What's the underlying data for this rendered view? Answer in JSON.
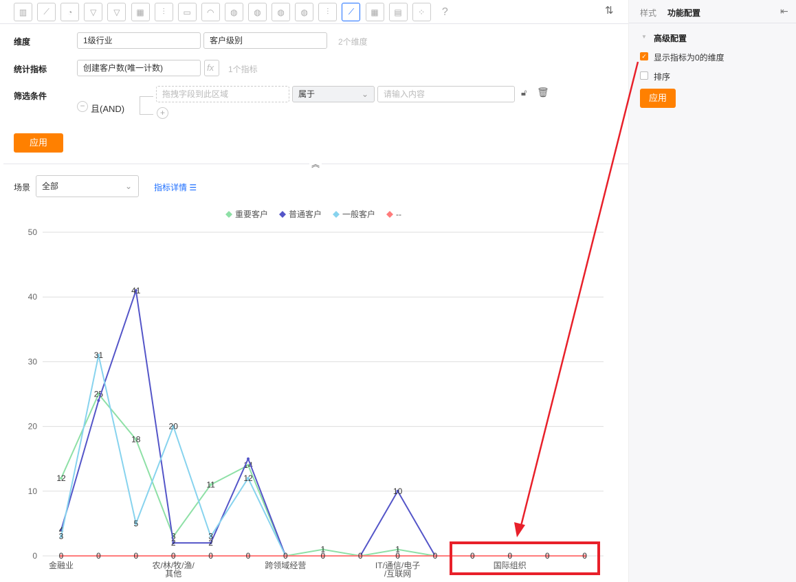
{
  "toolbar": {
    "icons": [
      "bar-chart",
      "line-chart",
      "pie-chart",
      "funnel",
      "funnel-compare",
      "table",
      "combo-chart",
      "card",
      "gauge",
      "china-map",
      "china-map-bubble",
      "world-map",
      "world-map-bubble",
      "bar-chart-thin",
      "line-chart-area",
      "heatmap",
      "detail-table",
      "scatter",
      "help"
    ],
    "active_index": 14,
    "help_glyph": "?"
  },
  "form": {
    "dimension_label": "维度",
    "dimensions": [
      "1级行业",
      "客户级别"
    ],
    "dimension_count": "2个维度",
    "metric_label": "统计指标",
    "metric": "创建客户数(唯一计数)",
    "fx": "fx",
    "metric_count": "1个指标",
    "filter_label": "筛选条件",
    "logic": "且(AND)",
    "drop_placeholder": "拖拽字段到此区域",
    "operator": "属于",
    "value_placeholder": "请输入内容",
    "apply": "应用"
  },
  "scene": {
    "label": "场景",
    "value": "全部",
    "detail_link": "指标详情"
  },
  "side": {
    "tabs": [
      "样式",
      "功能配置"
    ],
    "active_tab": 1,
    "section": "高级配置",
    "options": [
      {
        "label": "显示指标为0的维度",
        "checked": true
      },
      {
        "label": "排序",
        "checked": false
      }
    ],
    "apply": "应用"
  },
  "chart_data": {
    "type": "line",
    "categories": [
      "金融业",
      "",
      "",
      "农/林/牧/渔/其他",
      "",
      "",
      "跨领域经营",
      "",
      "",
      "IT/通信/电子/互联网",
      "",
      "",
      "国际组织",
      "",
      ""
    ],
    "ylim": [
      0,
      50
    ],
    "yticks": [
      0,
      10,
      20,
      30,
      40,
      50
    ],
    "grid": true,
    "legend": "top",
    "series": [
      {
        "name": "重要客户",
        "color": "#8ee0a6",
        "values": [
          12,
          25,
          18,
          3,
          11,
          14,
          0,
          1,
          0,
          1,
          0,
          0,
          0,
          0,
          0
        ]
      },
      {
        "name": "普通客户",
        "color": "#5455c8",
        "values": [
          4,
          24,
          41,
          2,
          2,
          15,
          0,
          0,
          0,
          10,
          0,
          0,
          0,
          0,
          0
        ]
      },
      {
        "name": "一般客户",
        "color": "#87d3ee",
        "values": [
          3,
          31,
          5,
          20,
          3,
          12,
          0,
          0,
          0,
          0,
          0,
          0,
          0,
          0,
          0
        ]
      },
      {
        "name": "--",
        "color": "#ff7b7b",
        "values": [
          0,
          0,
          0,
          0,
          0,
          0,
          0,
          0,
          0,
          0,
          0,
          0,
          0,
          0,
          0
        ]
      }
    ]
  },
  "annotation_color": "#e8202a"
}
